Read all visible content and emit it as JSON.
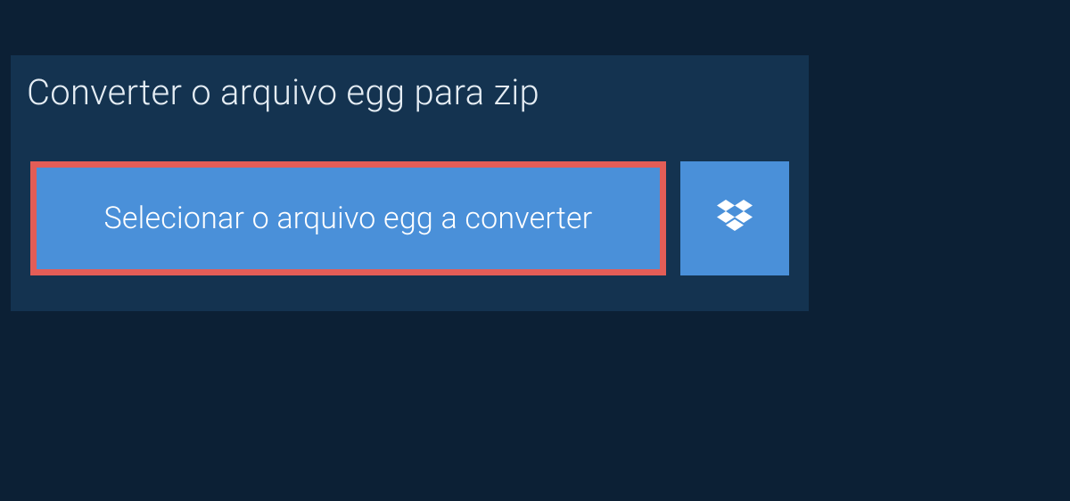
{
  "header": {
    "title": "Converter o arquivo egg para zip"
  },
  "actions": {
    "select_label": "Selecionar o arquivo egg a converter",
    "dropbox_icon": "dropbox-icon"
  },
  "colors": {
    "page_bg": "#0c2035",
    "panel_bg": "#143350",
    "button_bg": "#4a90d9",
    "button_border": "#e35d57",
    "text_light": "#ffffff",
    "title_text": "#e5edf4"
  }
}
